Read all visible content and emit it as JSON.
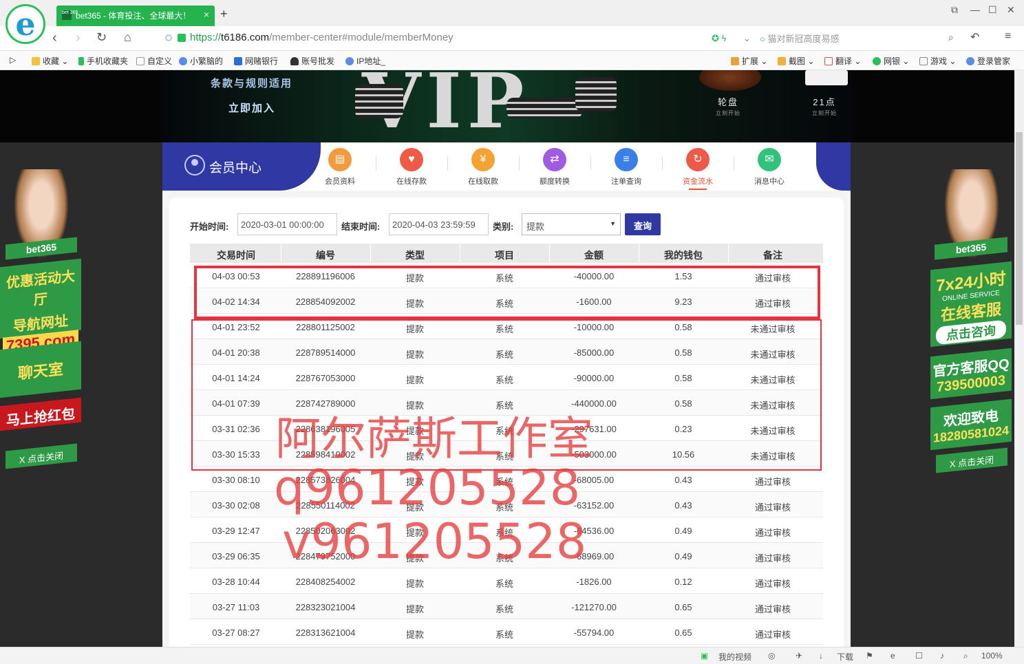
{
  "browser": {
    "tab_title": "bet365 - 体育投注、全球最大！",
    "tab_favicon": "bet 365",
    "tab_close": "×",
    "new_tab": "+",
    "url_scheme": "https://",
    "url_host": "t6186.com",
    "url_path": "/member-center#module/memberMoney",
    "search_placeholder": "猫对新冠高度易感",
    "window_controls": [
      "⧉",
      "—",
      "☐",
      "✕"
    ],
    "bookmarks": [
      "收藏",
      "手机收藏夹",
      "自定义",
      "小繁脑的",
      "网赌银行",
      "账号批发",
      "IP地址_"
    ],
    "toolbar_right": [
      "扩展",
      "截图",
      "翻译",
      "网银",
      "游戏",
      "登录管家"
    ]
  },
  "banner": {
    "terms": "条款与规则适用",
    "join": "立即加入",
    "vip": "VIP",
    "games": [
      {
        "name": "轮盘",
        "sub": "立刻开始"
      },
      {
        "name": "21点",
        "sub": "立刻开始"
      }
    ]
  },
  "member_nav": {
    "title": "会员中心",
    "items": [
      {
        "label": "会员资料",
        "icon": "profile-card-icon",
        "color": "#f39a3c",
        "glyph": "▤"
      },
      {
        "label": "在线存款",
        "icon": "piggy-bank-icon",
        "color": "#ef5a46",
        "glyph": "♥"
      },
      {
        "label": "在线取款",
        "icon": "yen-coin-icon",
        "color": "#f5a233",
        "glyph": "¥"
      },
      {
        "label": "额度转换",
        "icon": "transfer-icon",
        "color": "#a05be0",
        "glyph": "⇄"
      },
      {
        "label": "注单查询",
        "icon": "list-icon",
        "color": "#3a7ee8",
        "glyph": "≡"
      },
      {
        "label": "资金流水",
        "icon": "flow-icon",
        "color": "#ee5a4a",
        "glyph": "↻",
        "active": true
      },
      {
        "label": "消息中心",
        "icon": "mail-icon",
        "color": "#31c27c",
        "glyph": "✉"
      }
    ]
  },
  "filter": {
    "start_label": "开始时间:",
    "start_value": "2020-03-01 00:00:00",
    "end_label": "结束时间:",
    "end_value": "2020-04-03 23:59:59",
    "type_label": "类别:",
    "type_value": "提款",
    "query_button": "查询"
  },
  "table": {
    "headers": [
      "交易时间",
      "编号",
      "类型",
      "项目",
      "金额",
      "我的钱包",
      "备注"
    ],
    "rows": [
      [
        "04-03 00:53",
        "228891196006",
        "提款",
        "系统",
        "-40000.00",
        "1.53",
        "通过审核"
      ],
      [
        "04-02 14:34",
        "228854092002",
        "提款",
        "系统",
        "-1600.00",
        "9.23",
        "通过审核"
      ],
      [
        "04-01 23:52",
        "228801125002",
        "提款",
        "系统",
        "-10000.00",
        "0.58",
        "未通过审核"
      ],
      [
        "04-01 20:38",
        "228789514000",
        "提款",
        "系统",
        "-85000.00",
        "0.58",
        "未通过审核"
      ],
      [
        "04-01 14:24",
        "228767053000",
        "提款",
        "系统",
        "-90000.00",
        "0.58",
        "未通过审核"
      ],
      [
        "04-01 07:39",
        "228742789000",
        "提款",
        "系统",
        "-440000.00",
        "0.58",
        "未通过审核"
      ],
      [
        "03-31 02:36",
        "228638196005",
        "提款",
        "系统",
        "-297631.00",
        "0.23",
        "未通过审核"
      ],
      [
        "03-30 15:33",
        "228598419002",
        "提款",
        "系统",
        "-503000.00",
        "10.56",
        "未通过审核"
      ],
      [
        "03-30 08:10",
        "228573826004",
        "提款",
        "系统",
        "-68005.00",
        "0.43",
        "通过审核"
      ],
      [
        "03-30 02:08",
        "228550114002",
        "提款",
        "系统",
        "-63152.00",
        "0.43",
        "通过审核"
      ],
      [
        "03-29 12:47",
        "228502063002",
        "提款",
        "系统",
        "-64536.00",
        "0.49",
        "通过审核"
      ],
      [
        "03-29 06:35",
        "228479752000",
        "提款",
        "系统",
        "-68969.00",
        "0.49",
        "通过审核"
      ],
      [
        "03-28 10:44",
        "228408254002",
        "提款",
        "系统",
        "-1826.00",
        "0.12",
        "通过审核"
      ],
      [
        "03-27 11:03",
        "228323021004",
        "提款",
        "系统",
        "-121270.00",
        "0.65",
        "通过审核"
      ],
      [
        "03-27 08:27",
        "228313621004",
        "提款",
        "系统",
        "-55794.00",
        "0.65",
        "通过审核"
      ]
    ]
  },
  "watermark": {
    "line1": "阿尔萨斯工作室",
    "line2": "q961205528",
    "line3": "v961205528"
  },
  "left_ad": {
    "brand": "bet365",
    "promo": "优惠活动大厅",
    "nav": "导航网址",
    "domain": "7395.com",
    "chat": "聊天室",
    "redpacket": "马上抢红包",
    "close": "X 点击关闭"
  },
  "right_ad": {
    "brand": "bet365",
    "hours": "7x24小时",
    "online": "ONLINE SERVICE",
    "service": "在线客服",
    "consult": "点击咨询",
    "qq_label": "官方客服QQ",
    "qq": "739500003",
    "welcome": "欢迎致电",
    "phone": "18280581024",
    "close": "X 点击关闭"
  },
  "statusbar": {
    "items": [
      "我的视频",
      "下载",
      "100%"
    ]
  }
}
